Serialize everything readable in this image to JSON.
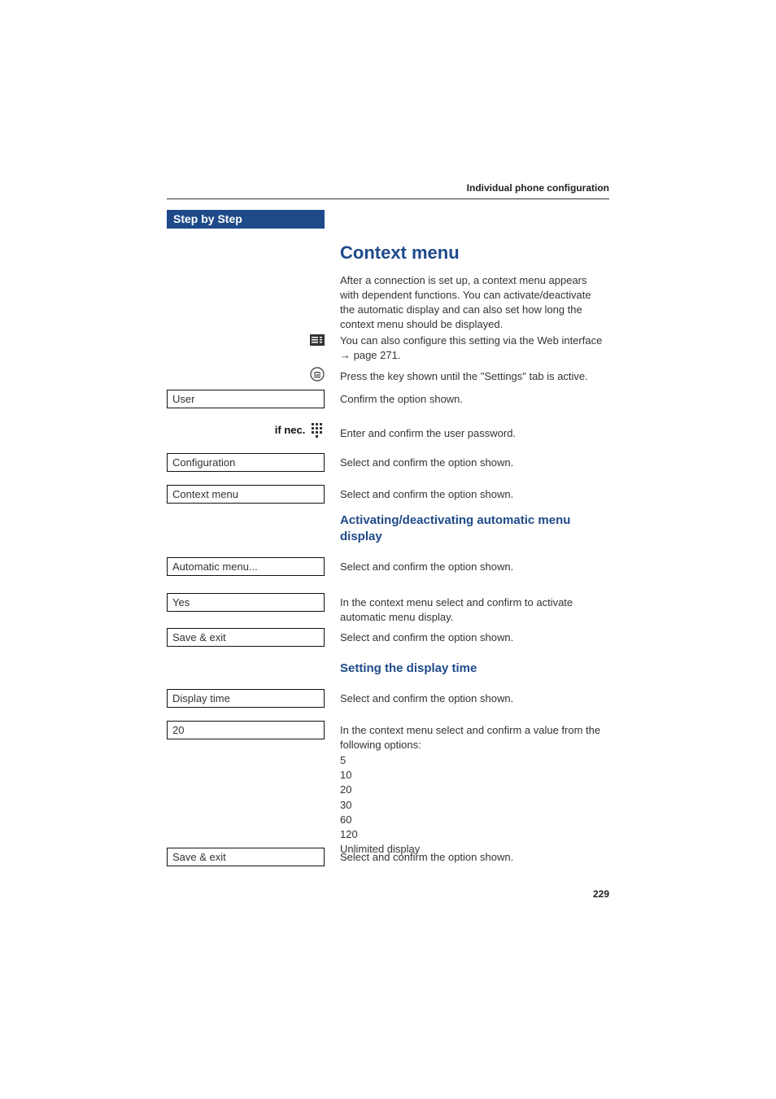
{
  "header": {
    "section_title": "Individual phone configuration"
  },
  "sidebar": {
    "title": "Step by Step",
    "labels": {
      "if_nec": "if nec."
    },
    "boxes": {
      "user": "User",
      "configuration": "Configuration",
      "context_menu": "Context menu",
      "automatic_menu": "Automatic menu...",
      "yes": "Yes",
      "save_exit_1": "Save & exit",
      "display_time": "Display time",
      "twenty": "20",
      "save_exit_2": "Save & exit"
    }
  },
  "content": {
    "h2_context_menu": "Context menu",
    "intro_para": "After a connection is set up, a context menu appears with dependent functions. You can activate/deactivate the automatic display and can also set how long the context menu should be displayed.",
    "web_config_a": "You can also configure this setting via the Web interface ",
    "web_config_arrow": "→",
    "web_config_b": " page 271.",
    "press_key": "Press the key shown until the \"Settings\" tab is active.",
    "confirm_option": "Confirm the option shown.",
    "enter_password": "Enter and confirm the user password.",
    "select_confirm": "Select and confirm the option shown.",
    "h3_activating": "Activating/deactivating automatic menu display",
    "context_activate": "In the context menu select and confirm to activate automatic menu display.",
    "h3_setting_time": "Setting the display time",
    "context_value": "In the context menu select and confirm a value from the following options:",
    "options": [
      "5",
      "10",
      "20",
      "30",
      "60",
      "120",
      "Unlimited display"
    ]
  },
  "page_number": "229"
}
